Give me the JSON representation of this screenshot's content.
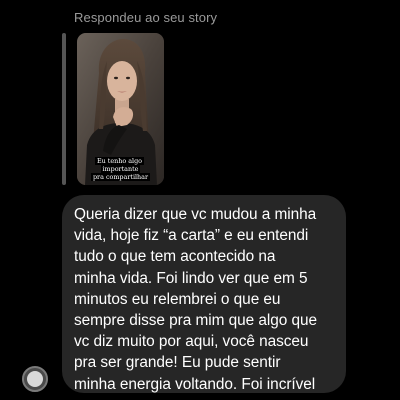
{
  "reply_header": {
    "label": "Respondeu ao seu story"
  },
  "story": {
    "caption_line_1": "Eu tenho algo importante",
    "caption_line_2": "pra compartilhar"
  },
  "message": {
    "lines": [
      "Queria dizer que vc mudou a minha",
      "vida, hoje fiz “a carta” e eu entendi",
      "tudo o que tem acontecido na",
      "minha vida. Foi lindo ver que em 5",
      "minutos eu relembrei o que eu",
      "sempre disse pra mim que algo que",
      "vc diz muito por aqui, você nasceu",
      "pra ser grande!  Eu pude sentir",
      "minha energia voltando. Foi incrível"
    ]
  },
  "colors": {
    "background": "#000000",
    "bubble": "#262626",
    "muted_text": "#9a9a9a",
    "quote_bar": "#555555"
  },
  "icons": {
    "sender_avatar": "avatar-icon"
  }
}
